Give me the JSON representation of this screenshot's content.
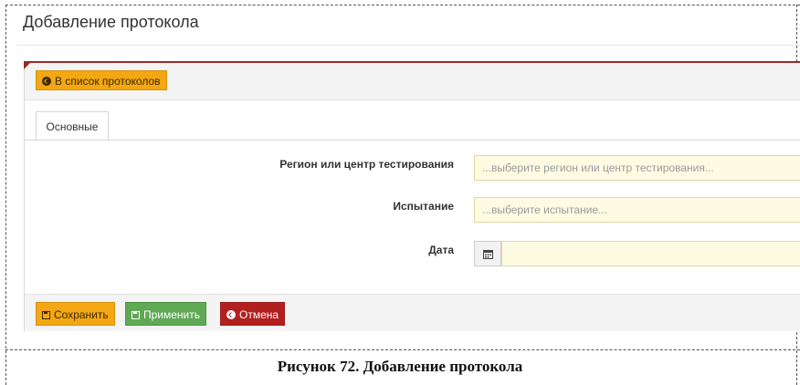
{
  "page": {
    "title": "Добавление протокола"
  },
  "toolbar": {
    "back_label": "В список протоколов"
  },
  "tabs": [
    {
      "label": "Основные"
    }
  ],
  "form": {
    "region": {
      "label": "Регион или центр тестирования",
      "placeholder": "...выберите регион или центр тестирования..."
    },
    "test": {
      "label": "Испытание",
      "placeholder": "...выберите испытание..."
    },
    "date": {
      "label": "Дата",
      "value": ""
    }
  },
  "footer": {
    "save_label": "Сохранить",
    "apply_label": "Применить",
    "cancel_label": "Отмена"
  },
  "caption": "Рисунок 72. Добавление протокола",
  "colors": {
    "accent": "#9b2b1f",
    "save": "#f3a712",
    "apply": "#5fa854",
    "cancel": "#b21f1f",
    "field": "#fffbe3"
  }
}
